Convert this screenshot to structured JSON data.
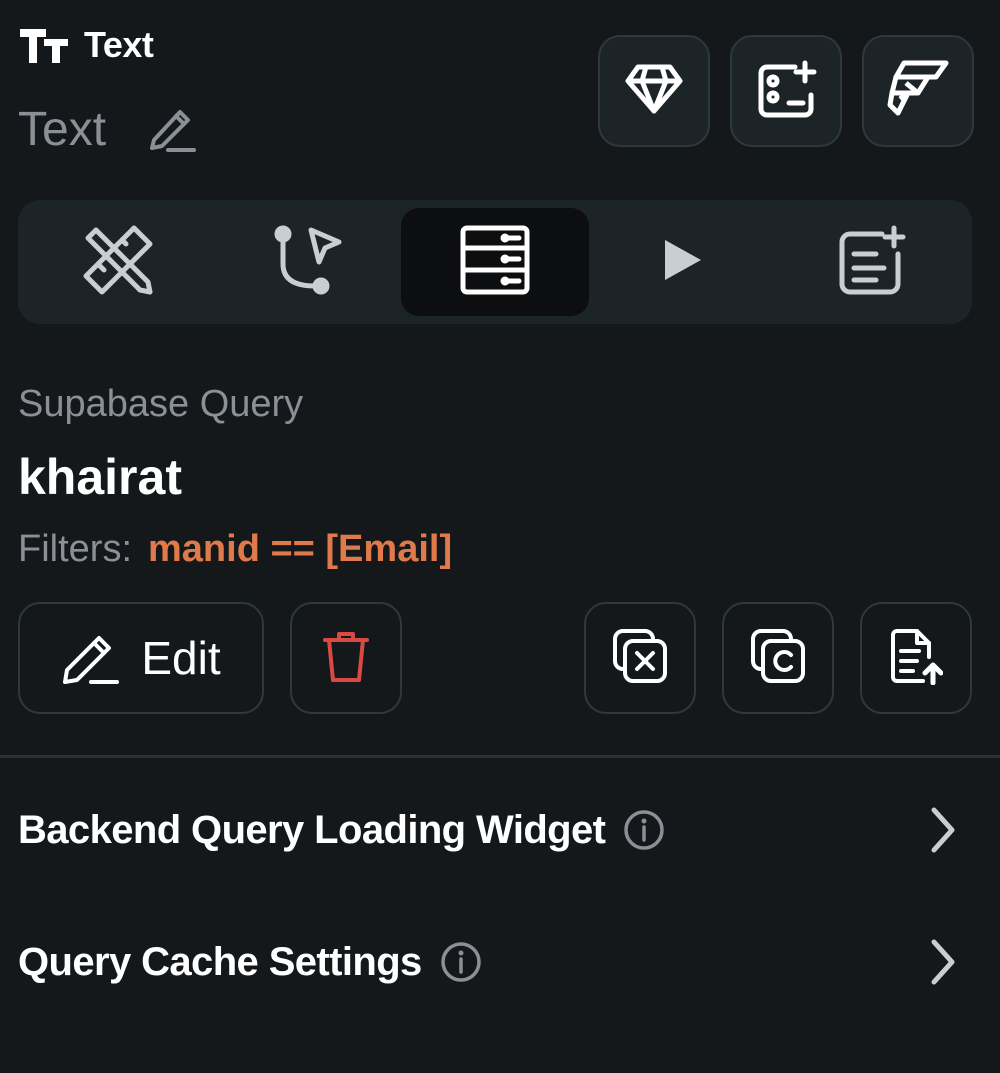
{
  "header": {
    "widget_type": "Text",
    "widget_name": "Text",
    "buttons": [
      "diamond-icon",
      "add-component-icon",
      "flutterflow-icon"
    ]
  },
  "tabs": {
    "items": [
      {
        "icon": "properties-ruler-pencil-icon",
        "active": false
      },
      {
        "icon": "actions-flow-cursor-icon",
        "active": false
      },
      {
        "icon": "backend-query-server-icon",
        "active": true
      },
      {
        "icon": "play-icon",
        "active": false
      },
      {
        "icon": "add-note-icon",
        "active": false
      }
    ]
  },
  "query": {
    "type_label": "Supabase Query",
    "name": "khairat",
    "filters_label": "Filters:",
    "filters_value": "manid == [Email]"
  },
  "actions": {
    "edit_label": "Edit",
    "right": [
      "variable-x-icon",
      "copy-c-icon",
      "export-doc-icon"
    ]
  },
  "sections": [
    {
      "label": "Backend Query Loading Widget"
    },
    {
      "label": "Query Cache Settings"
    }
  ],
  "colors": {
    "background": "#14181b",
    "surface": "#1d2428",
    "border": "#2f383d",
    "muted_text": "#8a9095",
    "accent_orange": "#e07a4a",
    "danger_red": "#d84a42"
  }
}
